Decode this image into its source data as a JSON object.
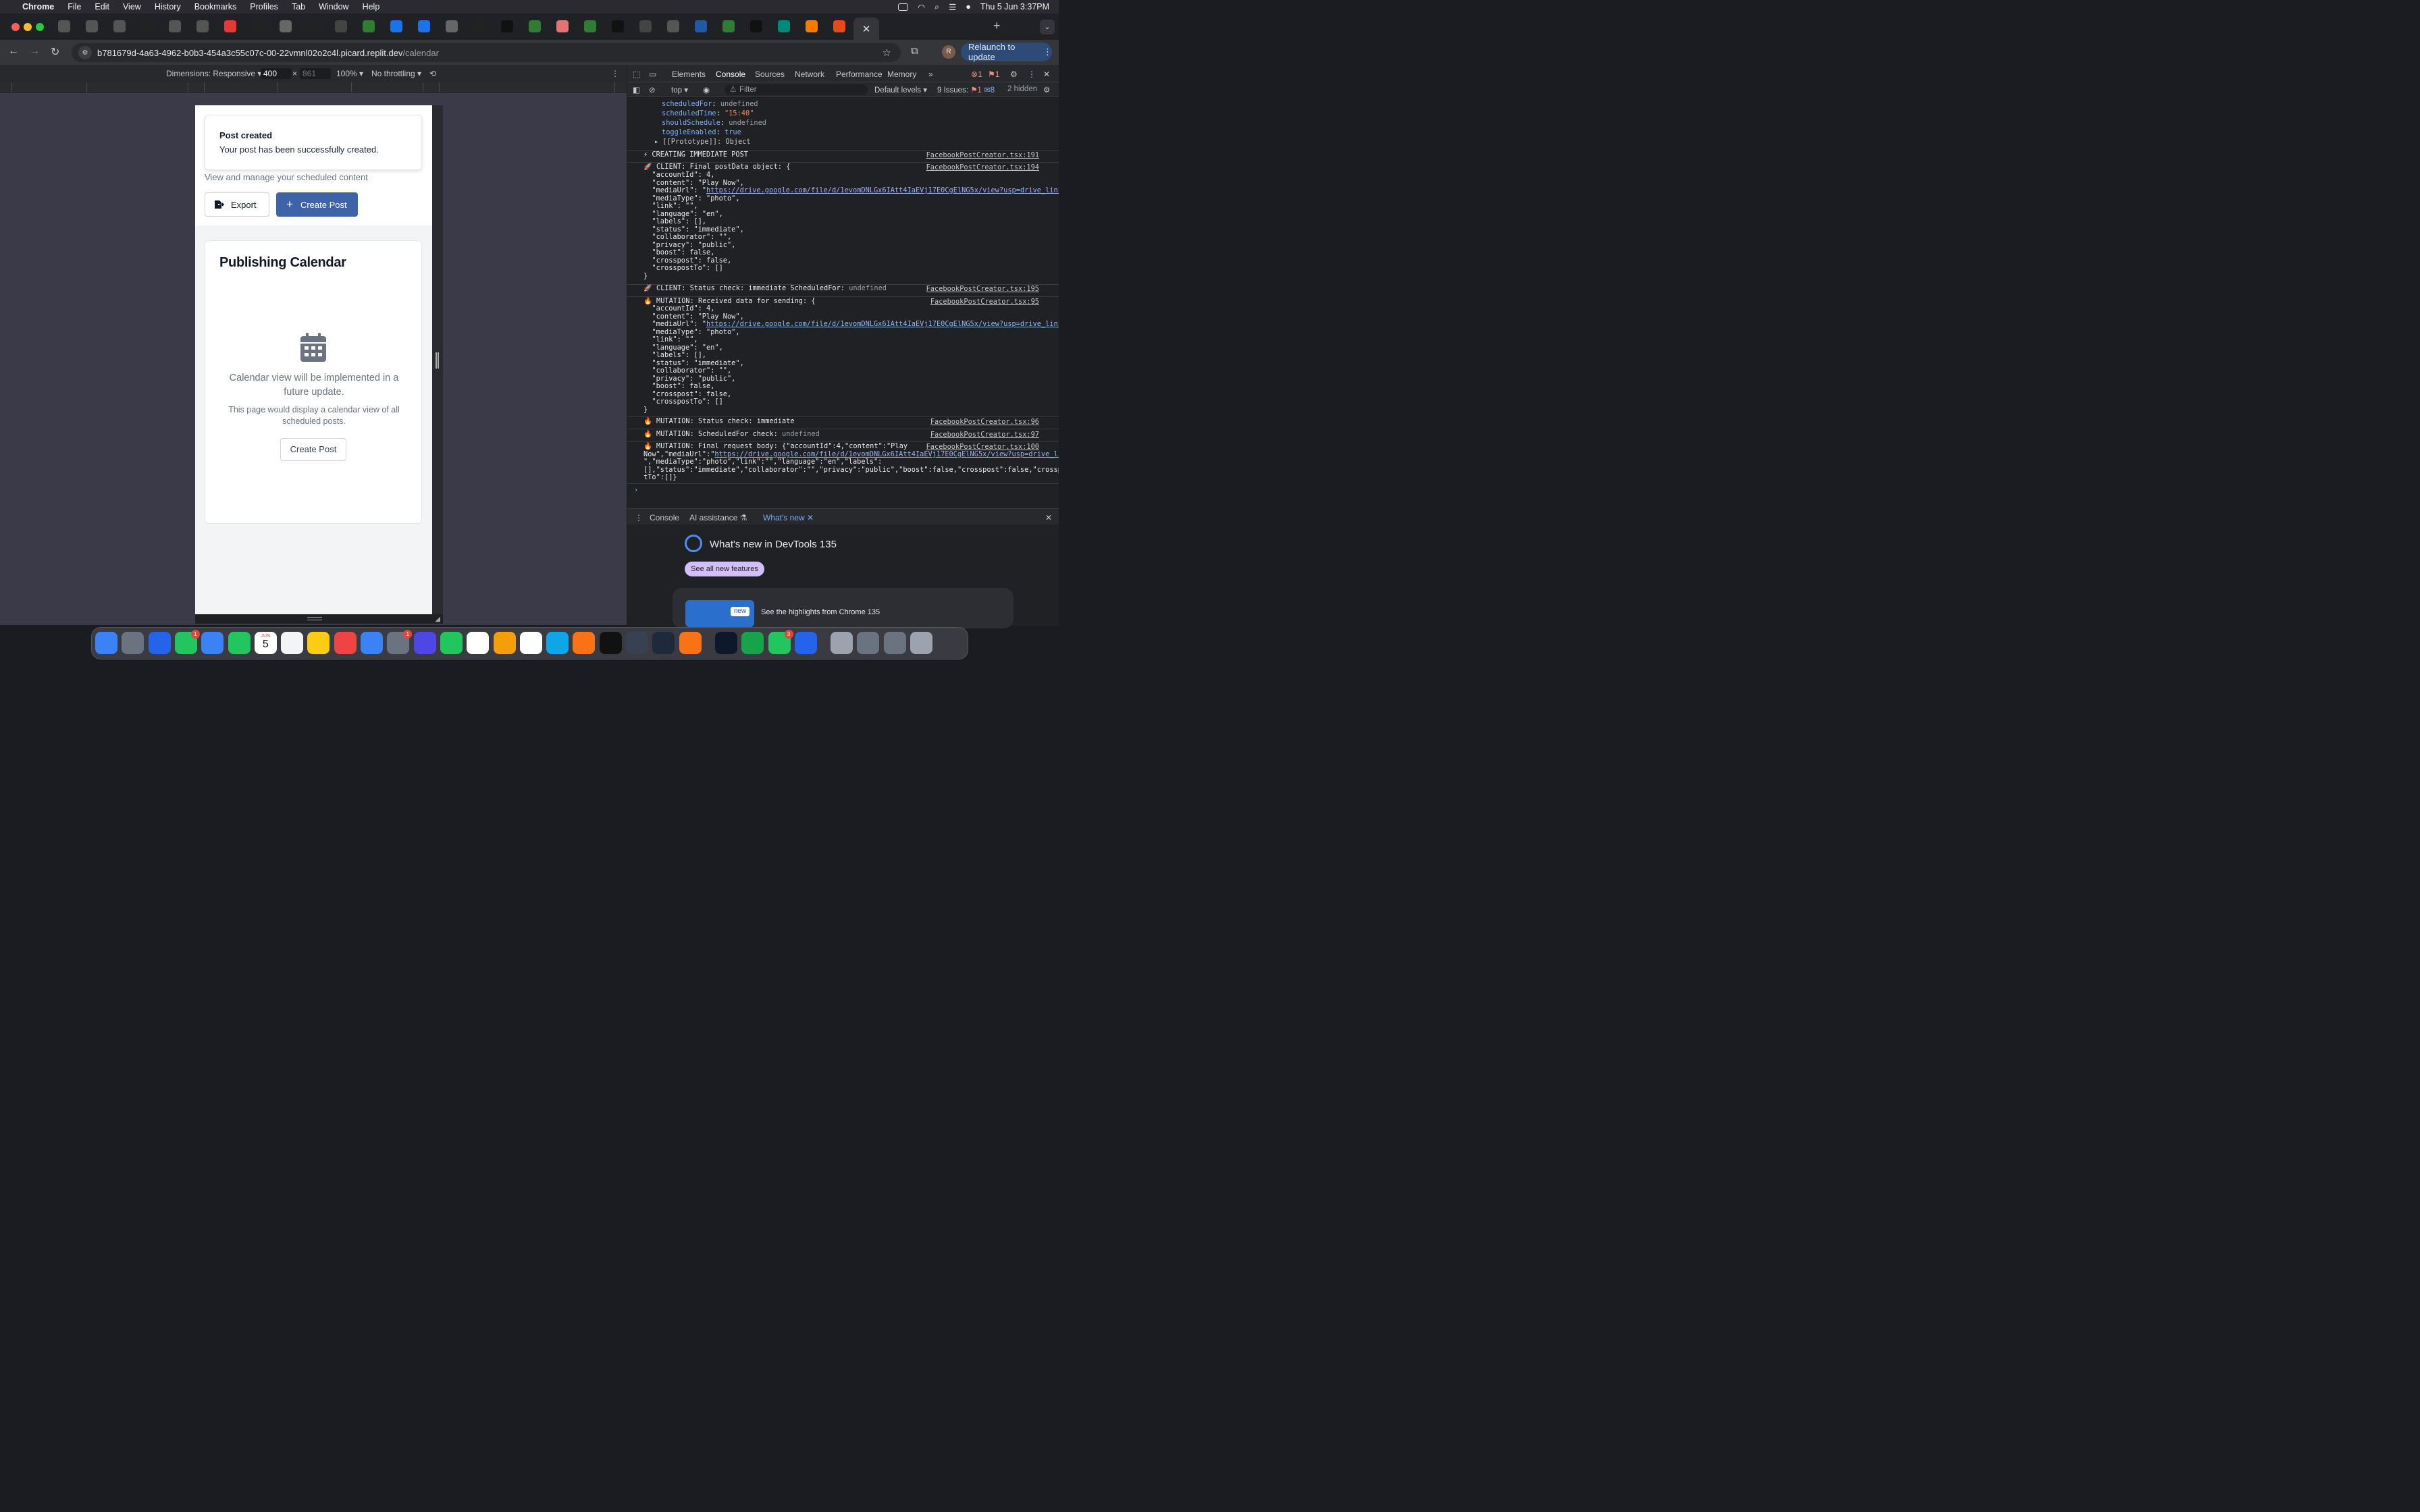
{
  "menubar": {
    "apple_icon": "apple-icon",
    "app": "Chrome",
    "items": [
      "File",
      "Edit",
      "View",
      "History",
      "Bookmarks",
      "Profiles",
      "Tab",
      "Window",
      "Help"
    ],
    "datetime": "Thu 5 Jun  3:37PM"
  },
  "browser": {
    "url_host": "b781679d-4a63-4962-b0b3-454a3c55c07c-00-22vmnl02o2c4l.picard.replit.dev",
    "url_path": "/calendar",
    "relaunch": "Relaunch to update",
    "avatar_letter": "R",
    "tab_count": 30,
    "colors": {
      "tab_accent": "#7cacf8",
      "relaunch_bg": "#2e4a76"
    }
  },
  "device_toolbar": {
    "dimensions_label": "Dimensions: Responsive",
    "width": "400",
    "x": "×",
    "height": "861",
    "zoom": "100%",
    "throttling": "No throttling"
  },
  "app": {
    "toast": {
      "title": "Post created",
      "message": "Your post has been successfully created."
    },
    "subtitle": "View and manage your scheduled content",
    "export_label": "Export",
    "create_label": "Create Post",
    "card": {
      "title": "Publishing Calendar",
      "message": "Calendar view will be implemented in a future update.",
      "detail": "This page would display a calendar view of all scheduled posts.",
      "button": "Create Post"
    },
    "colors": {
      "primary": "#3f63a8",
      "muted_text": "#6b7280"
    }
  },
  "devtools": {
    "tabs": [
      "Elements",
      "Console",
      "Sources",
      "Network",
      "Performance",
      "Memory"
    ],
    "active_tab": "Console",
    "error_count": "1",
    "warning_count": "1",
    "context": "top",
    "filter_placeholder": "Filter",
    "levels": "Default levels",
    "issues_label": "9 Issues:",
    "issues_err": "1",
    "issues_info": "8",
    "hidden": "2 hidden",
    "drawer_tabs": [
      "Console",
      "AI assistance",
      "What's new"
    ],
    "whatsnew_title": "What's new in DevTools 135",
    "whatsnew_button": "See all new features",
    "whatsnew_badge": "new",
    "whatsnew_highlight": "See the highlights from Chrome 135"
  },
  "console": {
    "obj_tail": [
      {
        "k": "scheduledFor",
        "v": "undefined",
        "t": "und"
      },
      {
        "k": "scheduledTime",
        "v": "\"15:40\"",
        "t": "str"
      },
      {
        "k": "shouldSchedule",
        "v": "undefined",
        "t": "und"
      },
      {
        "k": "toggleEnabled",
        "v": "true",
        "t": "key"
      }
    ],
    "prototype": "▸ [[Prototype]]: Object",
    "entries": [
      {
        "msg": "⚡ CREATING IMMEDIATE POST",
        "src": "FacebookPostCreator.tsx:191"
      },
      {
        "msg": "🚀 CLIENT: Final postData object: {",
        "src": "FacebookPostCreator.tsx:194"
      },
      {
        "msg": "🚀 CLIENT: Status check: immediate ScheduledFor: ",
        "tail": "undefined",
        "src": "FacebookPostCreator.tsx:195"
      },
      {
        "msg": "🔥 MUTATION: Received data for sending: {",
        "src": "FacebookPostCreator.tsx:95"
      },
      {
        "msg": "🔥 MUTATION: Status check: immediate",
        "src": "FacebookPostCreator.tsx:96"
      },
      {
        "msg": "🔥 MUTATION: ScheduledFor check: ",
        "tail": "undefined",
        "src": "FacebookPostCreator.tsx:97"
      },
      {
        "msg": "🔥 MUTATION: Final request body: {\"accountId\":4,\"content\":\"Play",
        "src": "FacebookPostCreator.tsx:100"
      }
    ],
    "json_lines": [
      "  \"accountId\": 4,",
      "  \"content\": \"Play Now\",",
      "  \"mediaUrl\": \"",
      "  \"mediaType\": \"photo\",",
      "  \"link\": \"\",",
      "  \"language\": \"en\",",
      "  \"labels\": [],",
      "  \"status\": \"immediate\",",
      "  \"collaborator\": \"\",",
      "  \"privacy\": \"public\",",
      "  \"boost\": false,",
      "  \"crosspost\": false,",
      "  \"crosspostTo\": []",
      "}"
    ],
    "media_url": "https://drive.google.com/file/d/1evomDNLGx6IAtt4IaEVj17E0CgElNG5x/view?usp=drive_link",
    "body_lines": [
      "Now\",\"mediaUrl\":\"",
      "\",\"mediaType\":\"photo\",\"link\":\"\",\"language\":\"en\",\"labels\":",
      "[],\"status\":\"immediate\",\"collaborator\":\"\",\"privacy\":\"public\",\"boost\":false,\"crosspost\":false,\"crossposts",
      "tTo\":[]}"
    ],
    "prompt": "›"
  },
  "dock": {
    "calendar_month": "JUN",
    "calendar_day": "5",
    "badges": [
      "1",
      "1",
      "3"
    ]
  }
}
